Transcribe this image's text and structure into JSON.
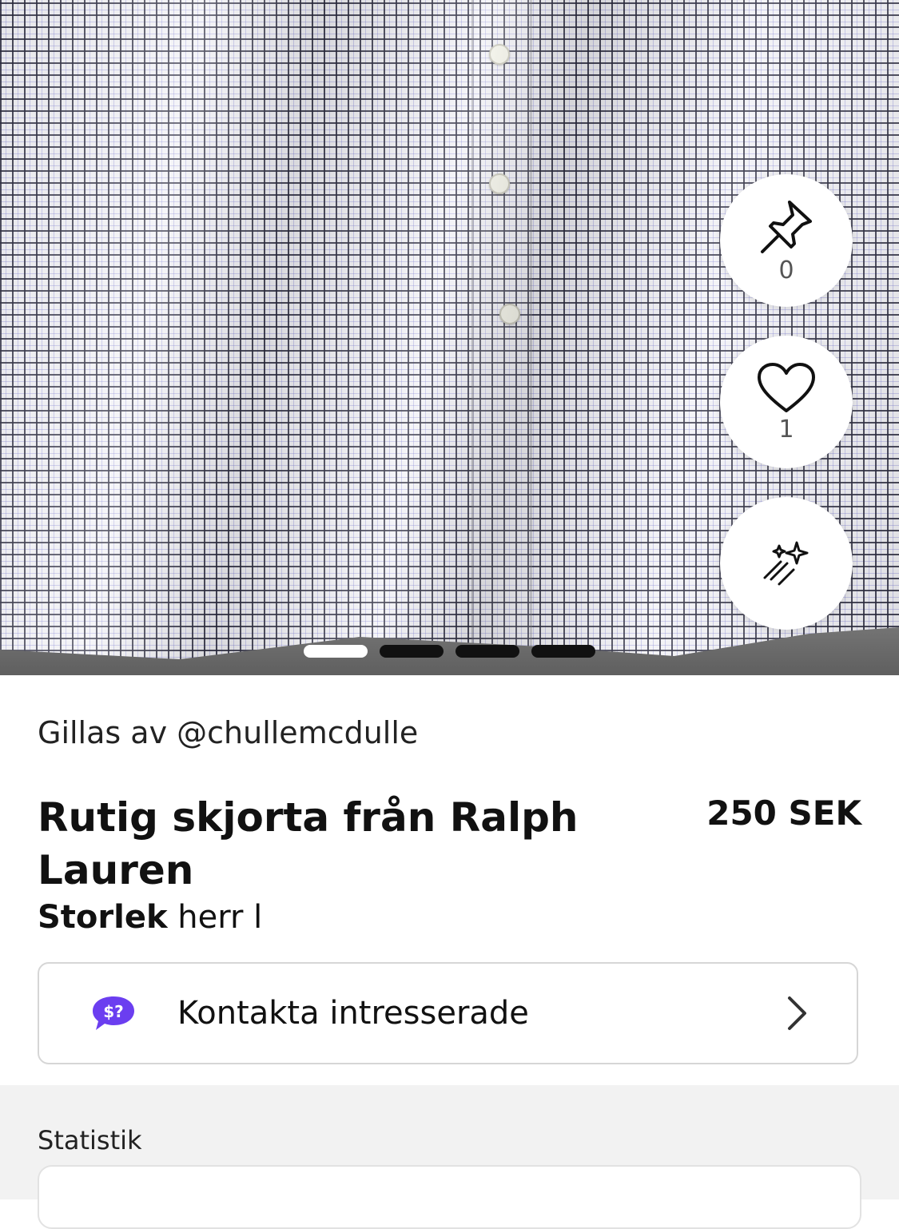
{
  "listing": {
    "liked_by": "Gillas av @chullemcdulle",
    "title": "Rutig skjorta från Ralph Lauren",
    "price": "250 SEK",
    "size_label": "Storlek",
    "size_value": "herr l"
  },
  "actions": {
    "pin_count": "0",
    "like_count": "1"
  },
  "carousel": {
    "total_images": 4,
    "active_index": 0
  },
  "contact": {
    "badge_text": "$?",
    "label": "Kontakta intresserade"
  },
  "stats": {
    "label": "Statistik"
  },
  "colors": {
    "accent": "#6b3ef0",
    "text": "#111111",
    "muted_bg": "#f2f2f2"
  }
}
